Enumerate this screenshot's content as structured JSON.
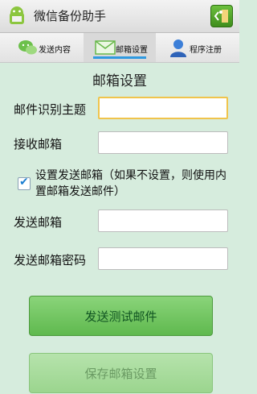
{
  "app": {
    "title": "微信备份助手"
  },
  "tabs": [
    {
      "label": "发送内容",
      "icon": "wechat-icon"
    },
    {
      "label": "邮箱设置",
      "icon": "envelope-icon"
    },
    {
      "label": "程序注册",
      "icon": "user-icon"
    }
  ],
  "section_title": "邮箱设置",
  "form": {
    "subject_label": "邮件识别主题",
    "subject_value": "",
    "receive_label": "接收邮箱",
    "receive_value": "",
    "checkbox_label": "设置发送邮箱（如果不设置，则使用内置邮箱发送邮件）",
    "checkbox_checked": true,
    "send_label": "发送邮箱",
    "send_value": "",
    "password_label": "发送邮箱密码",
    "password_value": ""
  },
  "buttons": {
    "test_label": "发送测试邮件",
    "save_label": "保存邮箱设置"
  },
  "colors": {
    "background": "#d6ecdd",
    "tab_indicator": "#2f9ae0",
    "button_green": "#6cc25b"
  }
}
